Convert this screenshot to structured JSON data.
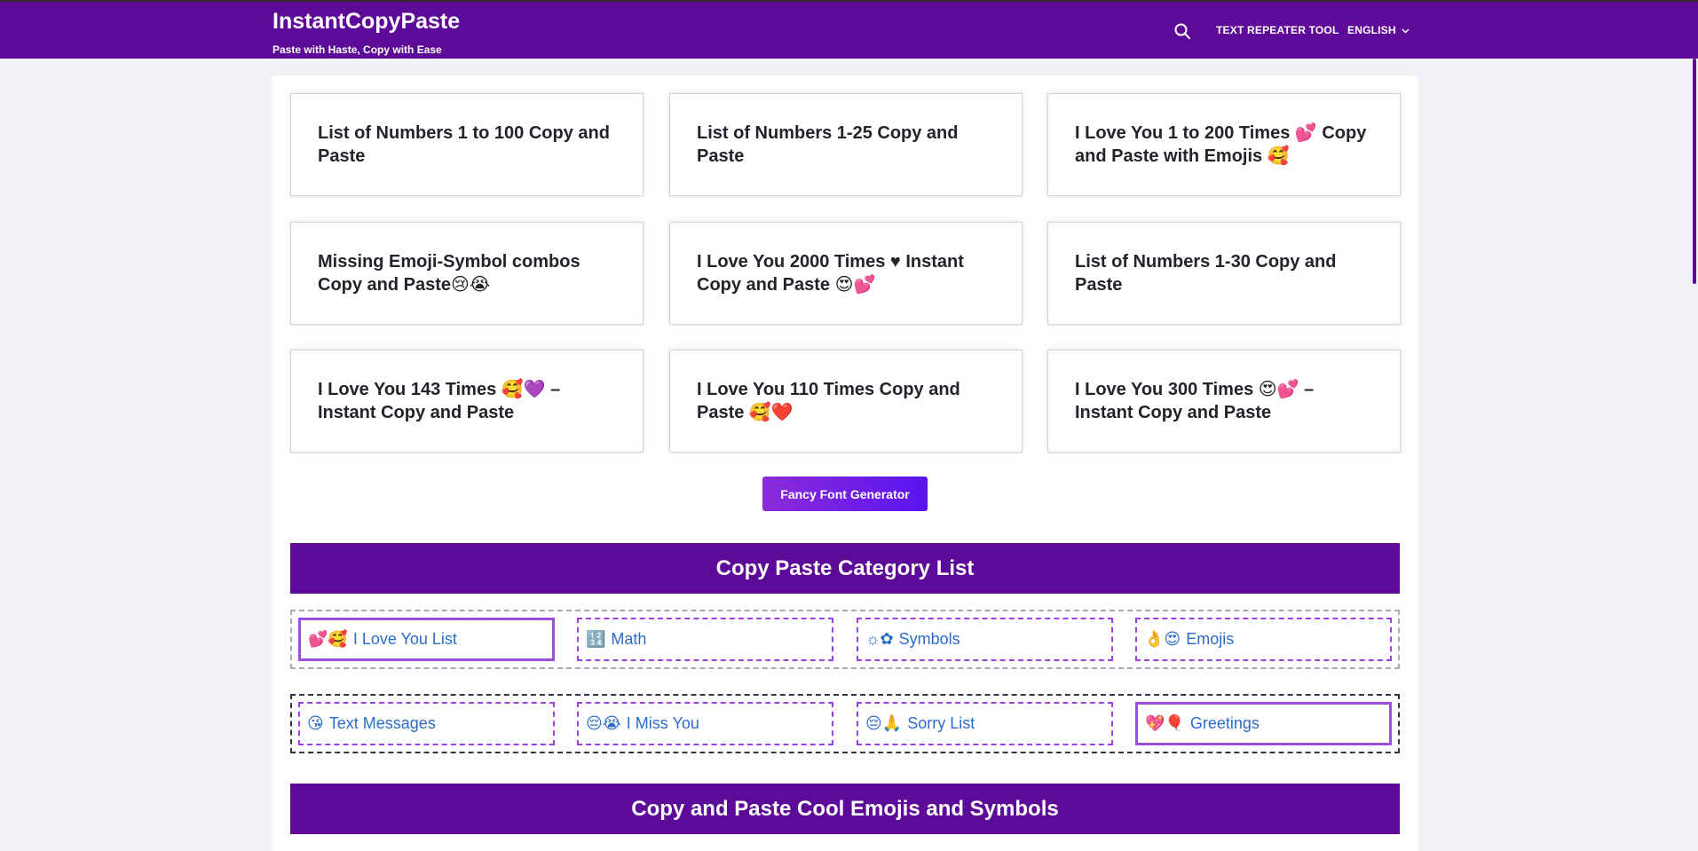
{
  "header": {
    "title": "InstantCopyPaste",
    "tagline": "Paste with Haste, Copy with Ease",
    "nav": {
      "tool": "TEXT REPEATER TOOL",
      "language": "ENGLISH"
    },
    "search_icon": "search-icon"
  },
  "cards": [
    {
      "title": "List of Numbers 1 to 100 Copy and Paste"
    },
    {
      "title": "List of Numbers 1-25 Copy and Paste"
    },
    {
      "title": "I Love You 1 to 200 Times 💕 Copy and Paste with Emojis 🥰"
    },
    {
      "title": "Missing Emoji-Symbol combos Copy and Paste😢😭"
    },
    {
      "title": "I Love You 2000 Times ♥ Instant Copy and Paste 😍💕"
    },
    {
      "title": "List of Numbers 1-30 Copy and Paste"
    },
    {
      "title": "I Love You 143 Times 🥰💜 – Instant Copy and Paste"
    },
    {
      "title": "I Love You 110 Times Copy and Paste 🥰❤️"
    },
    {
      "title": "I Love You 300 Times 😍💕 – Instant Copy and Paste"
    }
  ],
  "fancy_button": "Fancy Font Generator",
  "category_section": {
    "heading": "Copy Paste Category List",
    "row1": [
      {
        "emoji": "💕🥰",
        "label": "I Love You List"
      },
      {
        "emoji": "🔢",
        "label": "Math"
      },
      {
        "emoji": "☼✿",
        "label": "Symbols"
      },
      {
        "emoji": "👌😍",
        "label": "Emojis"
      }
    ],
    "row2": [
      {
        "emoji": "😘",
        "label": "Text Messages"
      },
      {
        "emoji": "😔😭",
        "label": "I Miss You"
      },
      {
        "emoji": "😔🙏",
        "label": "Sorry List"
      },
      {
        "emoji": "💖🎈",
        "label": "Greetings"
      }
    ]
  },
  "emoji_section": {
    "heading": "Copy and Paste Cool Emojis and Symbols"
  }
}
